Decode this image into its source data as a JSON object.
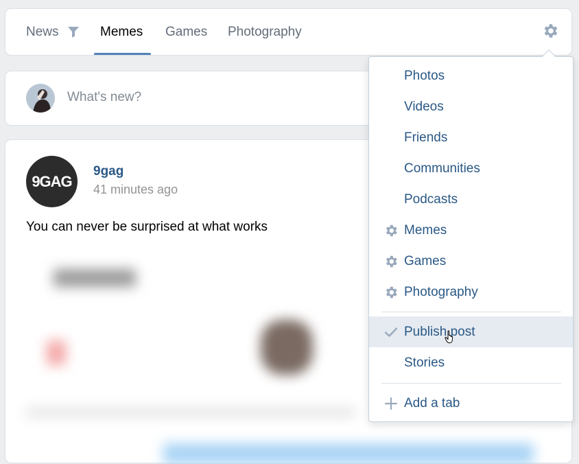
{
  "tabs": [
    {
      "label": "News",
      "icon": "filter-icon"
    },
    {
      "label": "Memes",
      "active": true
    },
    {
      "label": "Games"
    },
    {
      "label": "Photography"
    }
  ],
  "composer": {
    "placeholder": "What's new?"
  },
  "post": {
    "avatar_text": "9GAG",
    "author": "9gag",
    "time": "41 minutes ago",
    "text": "You can never be surprised at what works"
  },
  "menu": {
    "items": [
      {
        "label": "Photos"
      },
      {
        "label": "Videos"
      },
      {
        "label": "Friends"
      },
      {
        "label": "Communities"
      },
      {
        "label": "Podcasts"
      },
      {
        "label": "Memes",
        "icon": "gear-icon"
      },
      {
        "label": "Games",
        "icon": "gear-icon"
      },
      {
        "label": "Photography",
        "icon": "gear-icon"
      },
      {
        "label": "Publish post",
        "icon": "check-icon",
        "hovered": true
      },
      {
        "label": "Stories"
      },
      {
        "label": "Add a tab",
        "icon": "plus-icon"
      }
    ]
  },
  "colors": {
    "accent": "#5181b8",
    "link": "#2a5885",
    "icon": "#99a9bc",
    "background": "#edeef0"
  }
}
